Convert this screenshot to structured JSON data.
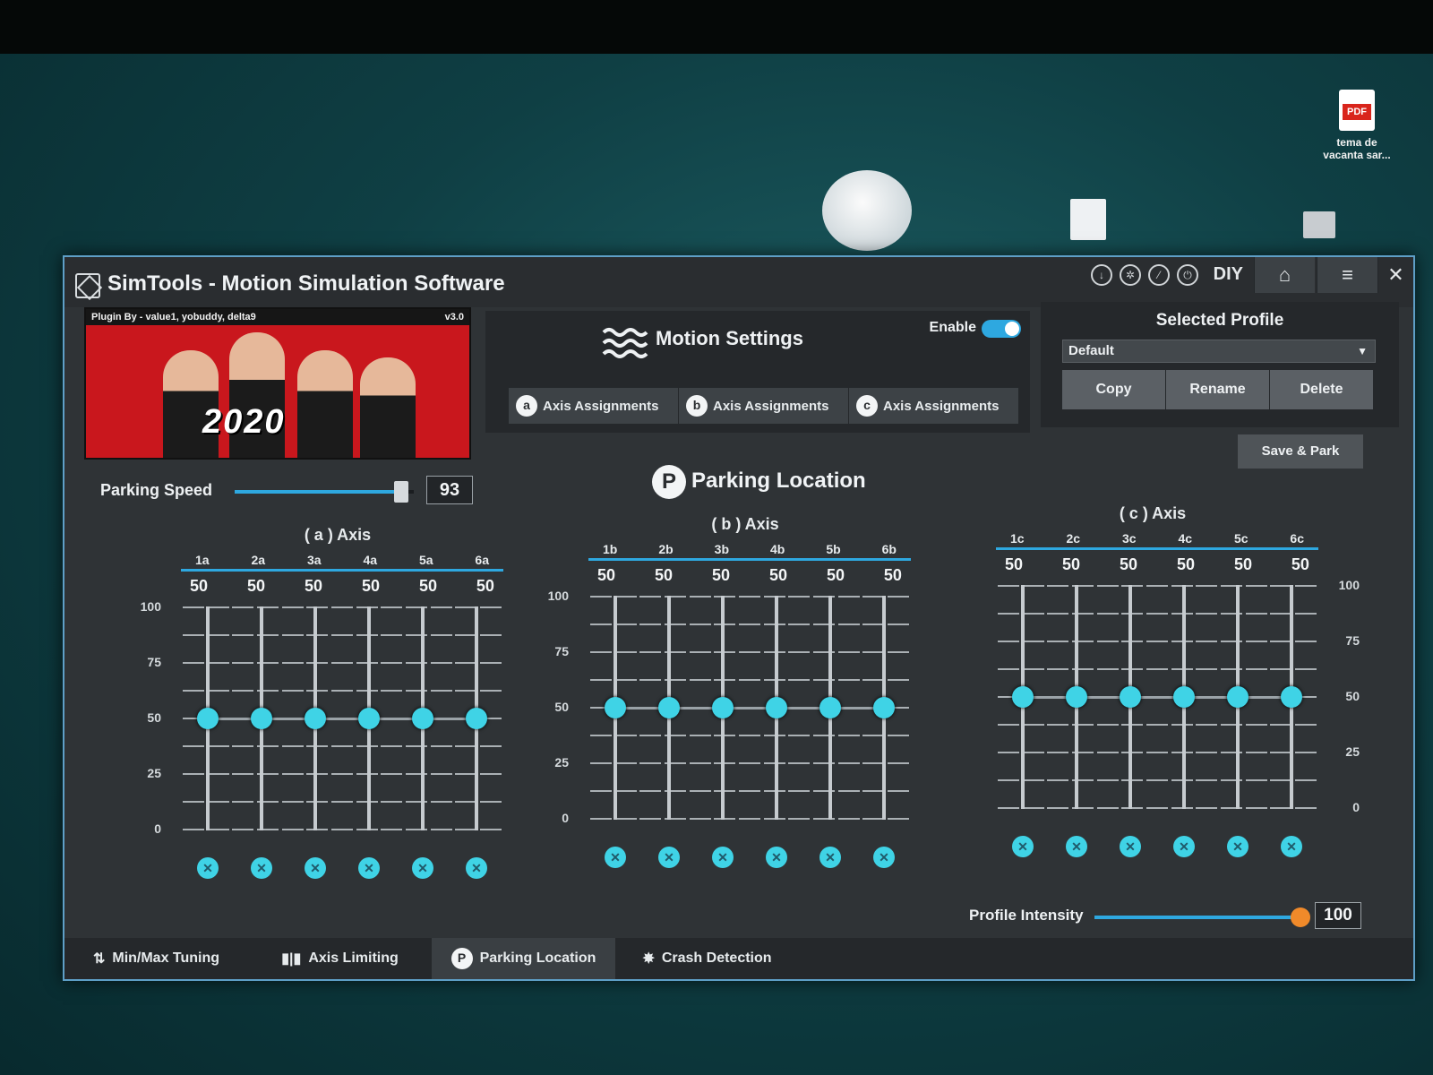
{
  "desktop": {
    "icons": [
      {
        "label": "tema de vacanta sar...",
        "badge": "PDF"
      }
    ]
  },
  "window": {
    "title": "SimTools - Motion Simulation Software",
    "diy_label": "DIY"
  },
  "banner": {
    "plugin_text": "Plugin By - value1, yobuddy, delta9",
    "version": "v3.0",
    "game_logo": "2020"
  },
  "motion_settings": {
    "title": "Motion Settings",
    "enable_label": "Enable",
    "enabled": true,
    "axis_tabs": [
      {
        "badge": "a",
        "label": "Axis Assignments"
      },
      {
        "badge": "b",
        "label": "Axis Assignments"
      },
      {
        "badge": "c",
        "label": "Axis Assignments"
      }
    ]
  },
  "profile": {
    "title": "Selected Profile",
    "selected": "Default",
    "buttons": [
      "Copy",
      "Rename",
      "Delete"
    ],
    "save_park": "Save & Park"
  },
  "parking": {
    "speed_label": "Parking Speed",
    "speed_value": "93",
    "speed_fraction": 0.93,
    "location_title": "Parking Location",
    "location_icon": "P"
  },
  "axis_groups": [
    {
      "title": "( a ) Axis",
      "columns": [
        "1a",
        "2a",
        "3a",
        "4a",
        "5a",
        "6a"
      ],
      "values": [
        "50",
        "50",
        "50",
        "50",
        "50",
        "50"
      ],
      "levels": [
        50,
        50,
        50,
        50,
        50,
        50
      ],
      "scale": [
        "100",
        "75",
        "50",
        "25",
        "0"
      ]
    },
    {
      "title": "( b ) Axis",
      "columns": [
        "1b",
        "2b",
        "3b",
        "4b",
        "5b",
        "6b"
      ],
      "values": [
        "50",
        "50",
        "50",
        "50",
        "50",
        "50"
      ],
      "levels": [
        50,
        50,
        50,
        50,
        50,
        50
      ],
      "scale": [
        "100",
        "75",
        "50",
        "25",
        "0"
      ]
    },
    {
      "title": "( c ) Axis",
      "columns": [
        "1c",
        "2c",
        "3c",
        "4c",
        "5c",
        "6c"
      ],
      "values": [
        "50",
        "50",
        "50",
        "50",
        "50",
        "50"
      ],
      "levels": [
        50,
        50,
        50,
        50,
        50,
        50
      ],
      "scale": [
        "100",
        "75",
        "50",
        "25",
        "0"
      ]
    }
  ],
  "intensity": {
    "label": "Profile Intensity",
    "value": "100",
    "fraction": 1.0
  },
  "bottom_tabs": [
    {
      "icon": "min-max-icon",
      "label": "Min/Max Tuning",
      "active": false
    },
    {
      "icon": "axis-limit-icon",
      "label": "Axis Limiting",
      "active": false
    },
    {
      "icon": "parking-icon",
      "label": "Parking Location",
      "active": true
    },
    {
      "icon": "crash-icon",
      "label": "Crash Detection",
      "active": false
    }
  ],
  "colors": {
    "accent": "#2ea8e0",
    "knob": "#3fd3e6",
    "intensity_thumb": "#f08a2a",
    "window_bg": "#2f3336"
  }
}
